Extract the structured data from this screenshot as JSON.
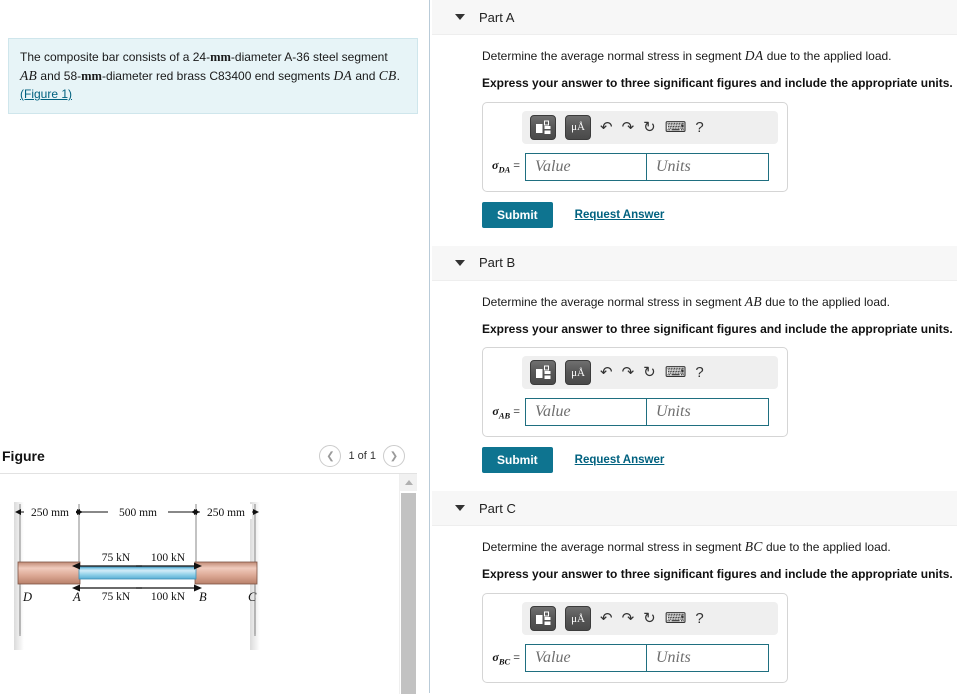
{
  "theme": {
    "accent_teal": "#0e7490",
    "link_blue": "#00617f",
    "question_bg": "#e7f4f7",
    "part_header_bg": "#f7f7f7",
    "field_border": "#1f6f80"
  },
  "question": {
    "text_part1": "The composite bar consists of a 24-",
    "unit1": "mm",
    "text_part2": "-diameter A-36 steel segment ",
    "seg1": "AB",
    "text_part3": " and 58-",
    "unit2": "mm",
    "text_part4": "-diameter red brass C83400 end segments ",
    "seg2": "DA",
    "text_part5": " and ",
    "seg3": "CB",
    "text_part6": ". ",
    "figure_link": "(Figure 1)"
  },
  "figure": {
    "title": "Figure",
    "prev_icon": "chevron-left-icon",
    "next_icon": "chevron-right-icon",
    "counter": "1 of 1",
    "labels": {
      "dim_left": "250 mm",
      "dim_mid": "500 mm",
      "dim_right": "250 mm",
      "force_left_top": "75 kN",
      "force_left_bottom": "75 kN",
      "force_right_top": "100 kN",
      "force_right_bottom": "100 kN",
      "node_d": "D",
      "node_a": "A",
      "node_b": "B",
      "node_c": "C"
    },
    "colors": {
      "brass": "#d9a18c",
      "brass_light": "#efc8ba",
      "steel": "#8fd0e8",
      "steel_light": "#cbeaf6"
    }
  },
  "toolbar": {
    "template_icon": "math-template-icon",
    "units_icon": "micro-angstrom-units-icon",
    "units_label": "μÅ",
    "undo_icon": "undo-icon",
    "undo_glyph": "↶",
    "redo_icon": "redo-icon",
    "redo_glyph": "↷",
    "reset_icon": "reset-icon",
    "reset_glyph": "↻",
    "keyboard_icon": "keyboard-icon",
    "keyboard_glyph": "⌨",
    "help_icon": "help-icon",
    "help_glyph": "?"
  },
  "common": {
    "caret_icon": "chevron-down-icon",
    "value_placeholder": "Value",
    "units_placeholder": "Units",
    "submit_label": "Submit",
    "request_answer_label": "Request Answer",
    "instruction": "Express your answer to three significant figures and include the appropriate units.",
    "prompt_prefix": "Determine the average normal stress in segment ",
    "prompt_suffix": " due to the applied load.",
    "sigma": "σ",
    "equals": "="
  },
  "parts": [
    {
      "label": "Part A",
      "segment": "DA",
      "sigma_sub": "DA",
      "value": "",
      "units": "",
      "has_submit": true
    },
    {
      "label": "Part B",
      "segment": "AB",
      "sigma_sub": "AB",
      "value": "",
      "units": "",
      "has_submit": true
    },
    {
      "label": "Part C",
      "segment": "BC",
      "sigma_sub": "BC",
      "value": "",
      "units": "",
      "has_submit": false
    }
  ]
}
